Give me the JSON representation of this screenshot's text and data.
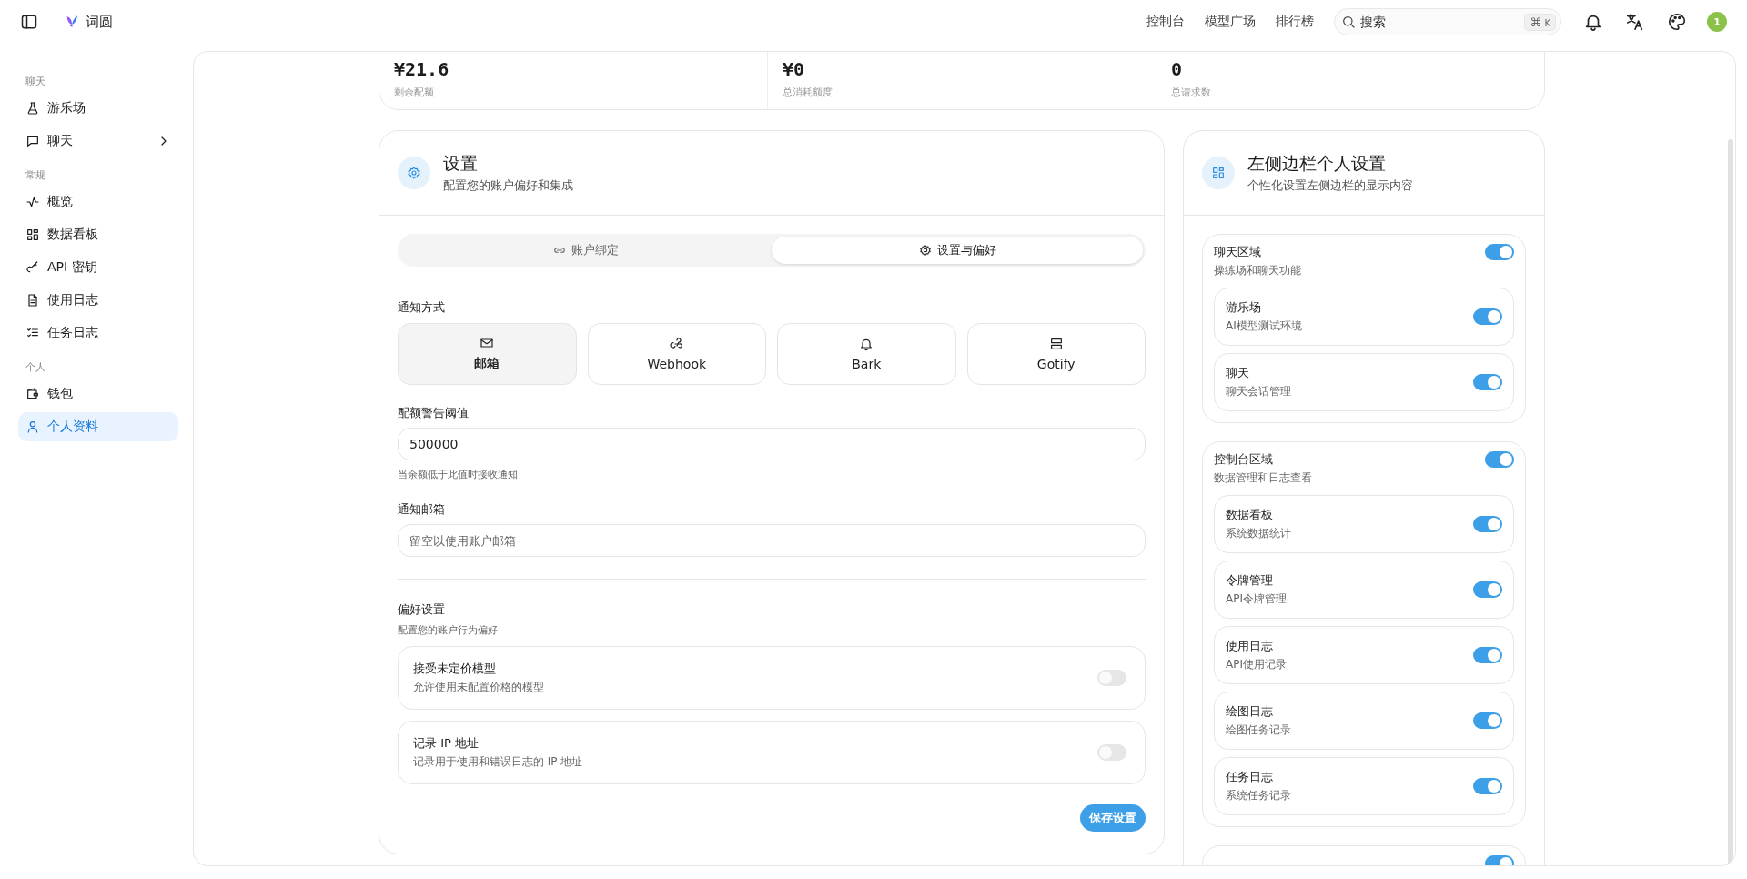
{
  "topbar": {
    "brand": "词圆",
    "nav": [
      {
        "label": "控制台"
      },
      {
        "label": "模型广场"
      },
      {
        "label": "排行榜"
      }
    ],
    "search": {
      "placeholder": "搜索",
      "shortcut_symbol": "⌘",
      "shortcut_key": "K"
    },
    "avatar": "1"
  },
  "sidebar": {
    "sections": [
      {
        "title": "聊天",
        "items": [
          {
            "label": "游乐场",
            "selected": false,
            "has_submenu": false
          },
          {
            "label": "聊天",
            "selected": false,
            "has_submenu": true
          }
        ]
      },
      {
        "title": "常规",
        "items": [
          {
            "label": "概览",
            "selected": false,
            "has_submenu": false
          },
          {
            "label": "数据看板",
            "selected": false,
            "has_submenu": false
          },
          {
            "label": "API 密钥",
            "selected": false,
            "has_submenu": false
          },
          {
            "label": "使用日志",
            "selected": false,
            "has_submenu": false
          },
          {
            "label": "任务日志",
            "selected": false,
            "has_submenu": false
          }
        ]
      },
      {
        "title": "个人",
        "items": [
          {
            "label": "钱包",
            "selected": false,
            "has_submenu": false
          },
          {
            "label": "个人资料",
            "selected": true,
            "has_submenu": false
          }
        ]
      }
    ]
  },
  "stats": [
    {
      "value": "¥21.6",
      "label": "剩余配额"
    },
    {
      "value": "¥0",
      "label": "总消耗额度"
    },
    {
      "value": "0",
      "label": "总请求数"
    }
  ],
  "settings": {
    "title": "设置",
    "subtitle": "配置您的账户偏好和集成",
    "tabs": [
      {
        "label": "账户绑定",
        "selected": false
      },
      {
        "label": "设置与偏好",
        "selected": true
      }
    ],
    "notify_label": "通知方式",
    "methods": [
      {
        "label": "邮箱",
        "selected": true
      },
      {
        "label": "Webhook",
        "selected": false
      },
      {
        "label": "Bark",
        "selected": false
      },
      {
        "label": "Gotify",
        "selected": false
      }
    ],
    "threshold": {
      "label": "配额警告阈值",
      "value": "500000",
      "hint": "当余额低于此值时接收通知"
    },
    "email": {
      "label": "通知邮箱",
      "placeholder": "留空以使用账户邮箱"
    },
    "prefs": {
      "title": "偏好设置",
      "subtitle": "配置您的账户行为偏好",
      "items": [
        {
          "title": "接受未定价模型",
          "desc": "允许使用未配置价格的模型",
          "on": false
        },
        {
          "title": "记录 IP 地址",
          "desc": "记录用于使用和错误日志的 IP 地址",
          "on": false
        }
      ]
    },
    "save_button": "保存设置"
  },
  "sidebar_settings": {
    "title": "左侧边栏个人设置",
    "subtitle": "个性化设置左侧边栏的显示内容",
    "groups": [
      {
        "title": "聊天区域",
        "desc": "操练场和聊天功能",
        "on": true,
        "items": [
          {
            "title": "游乐场",
            "desc": "AI模型测试环境",
            "on": true
          },
          {
            "title": "聊天",
            "desc": "聊天会话管理",
            "on": true
          }
        ]
      },
      {
        "title": "控制台区域",
        "desc": "数据管理和日志查看",
        "on": true,
        "items": [
          {
            "title": "数据看板",
            "desc": "系统数据统计",
            "on": true
          },
          {
            "title": "令牌管理",
            "desc": "API令牌管理",
            "on": true
          },
          {
            "title": "使用日志",
            "desc": "API使用记录",
            "on": true
          },
          {
            "title": "绘图日志",
            "desc": "绘图任务记录",
            "on": true
          },
          {
            "title": "任务日志",
            "desc": "系统任务记录",
            "on": true
          }
        ]
      },
      {
        "on": true
      }
    ]
  }
}
